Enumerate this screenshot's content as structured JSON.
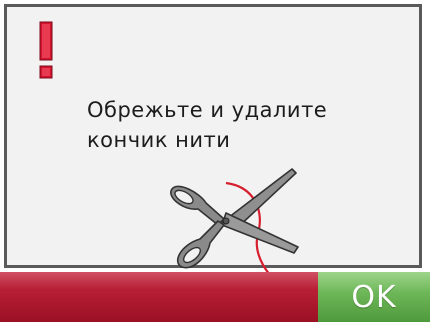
{
  "dialog": {
    "alert_icon": "exclamation-icon",
    "message_line1": "Обрежьте и удалите",
    "message_line2": "кончик нити",
    "illustration_icon": "scissors-cutting-thread-icon"
  },
  "footer": {
    "ok_label": "OK"
  },
  "colors": {
    "alert_red": "#c8102e",
    "thread_red": "#d81e2e",
    "ok_green": "#6fb85a",
    "bar_red": "#b81f35"
  }
}
